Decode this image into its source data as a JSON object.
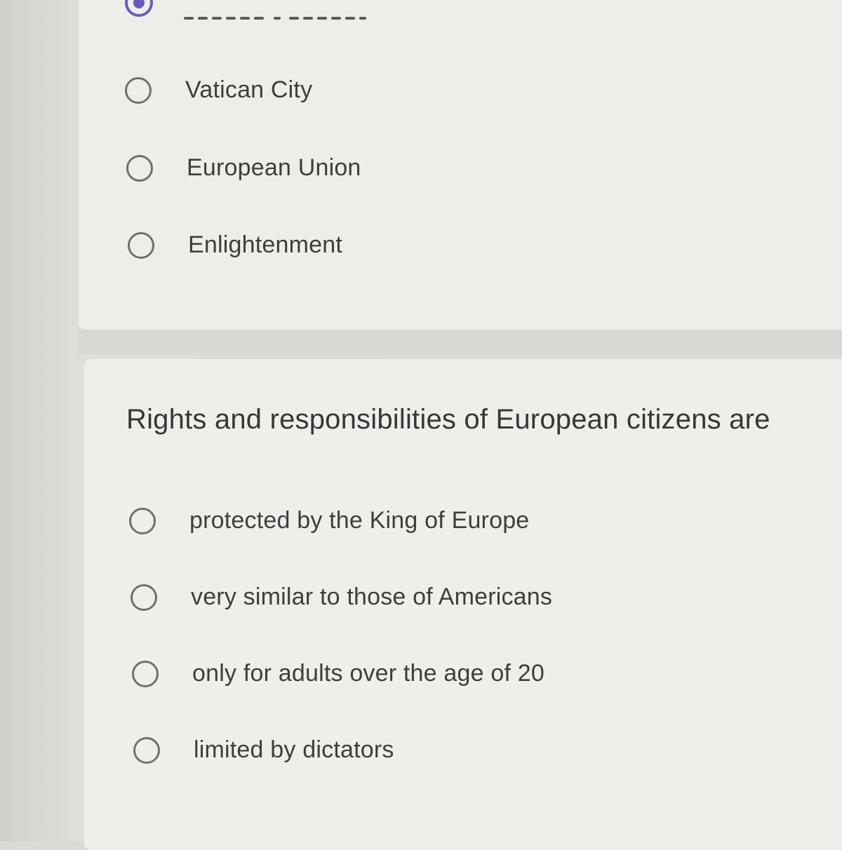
{
  "question_1": {
    "options": [
      {
        "label": "Vatican City"
      },
      {
        "label": "European Union"
      },
      {
        "label": "Enlightenment"
      }
    ]
  },
  "question_2": {
    "title": "Rights and responsibilities of European citizens are",
    "options": [
      {
        "label": "protected by the King of Europe"
      },
      {
        "label": "very similar to those of Americans"
      },
      {
        "label": "only for adults over the age of 20"
      },
      {
        "label": "limited by dictators"
      }
    ]
  },
  "colors": {
    "accent": "#6b5bb8",
    "card_background": "#ecefe9",
    "page_background": "#d9dcd6",
    "text": "#3d3f3c",
    "radio_border": "#6e706d"
  }
}
